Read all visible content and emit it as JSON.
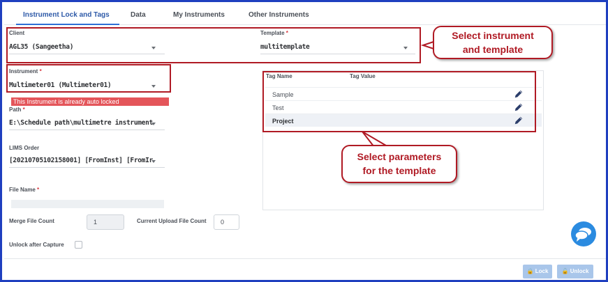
{
  "tabs": [
    "Instrument Lock and Tags",
    "Data",
    "My Instruments",
    "Other Instruments"
  ],
  "client": {
    "label": "Client",
    "value": "AGL35 (Sangeetha)"
  },
  "template": {
    "label": "Template",
    "required_mark": "*",
    "value": "multitemplate"
  },
  "instrument": {
    "label": "Instrument",
    "required_mark": "*",
    "value": "Multimeter01 (Multimeter01)",
    "error": "This Instrument is already auto locked"
  },
  "path": {
    "label": "Path",
    "required_mark": "*",
    "value": "E:\\Schedule path\\multimetre instrument"
  },
  "lims": {
    "label": "LIMS Order",
    "value": "[20210705102158001] [FromInst] [FromIr"
  },
  "file_name": {
    "label": "File Name",
    "required_mark": "*"
  },
  "merge": {
    "label": "Merge File Count",
    "value": "1"
  },
  "upload": {
    "label": "Current Upload File Count",
    "value": "0"
  },
  "unlock_capture": {
    "label": "Unlock after Capture"
  },
  "tags": {
    "header_name": "Tag Name",
    "header_value": "Tag Value",
    "rows": [
      "Sample",
      "Test",
      "Project"
    ]
  },
  "callouts": {
    "instrument": [
      "Select instrument",
      "and template"
    ],
    "parameters": [
      "Select parameters",
      "for the template"
    ]
  },
  "buttons": {
    "lock": "Lock",
    "unlock": "Unlock"
  },
  "colors": {
    "accent": "#2e6fd6",
    "callout": "#b01a24",
    "error": "#e4555a",
    "button": "#a9c6ea"
  },
  "icons": [
    "pencil-icon",
    "chat-icon",
    "lock-icon",
    "unlock-icon",
    "caret-down-icon"
  ]
}
